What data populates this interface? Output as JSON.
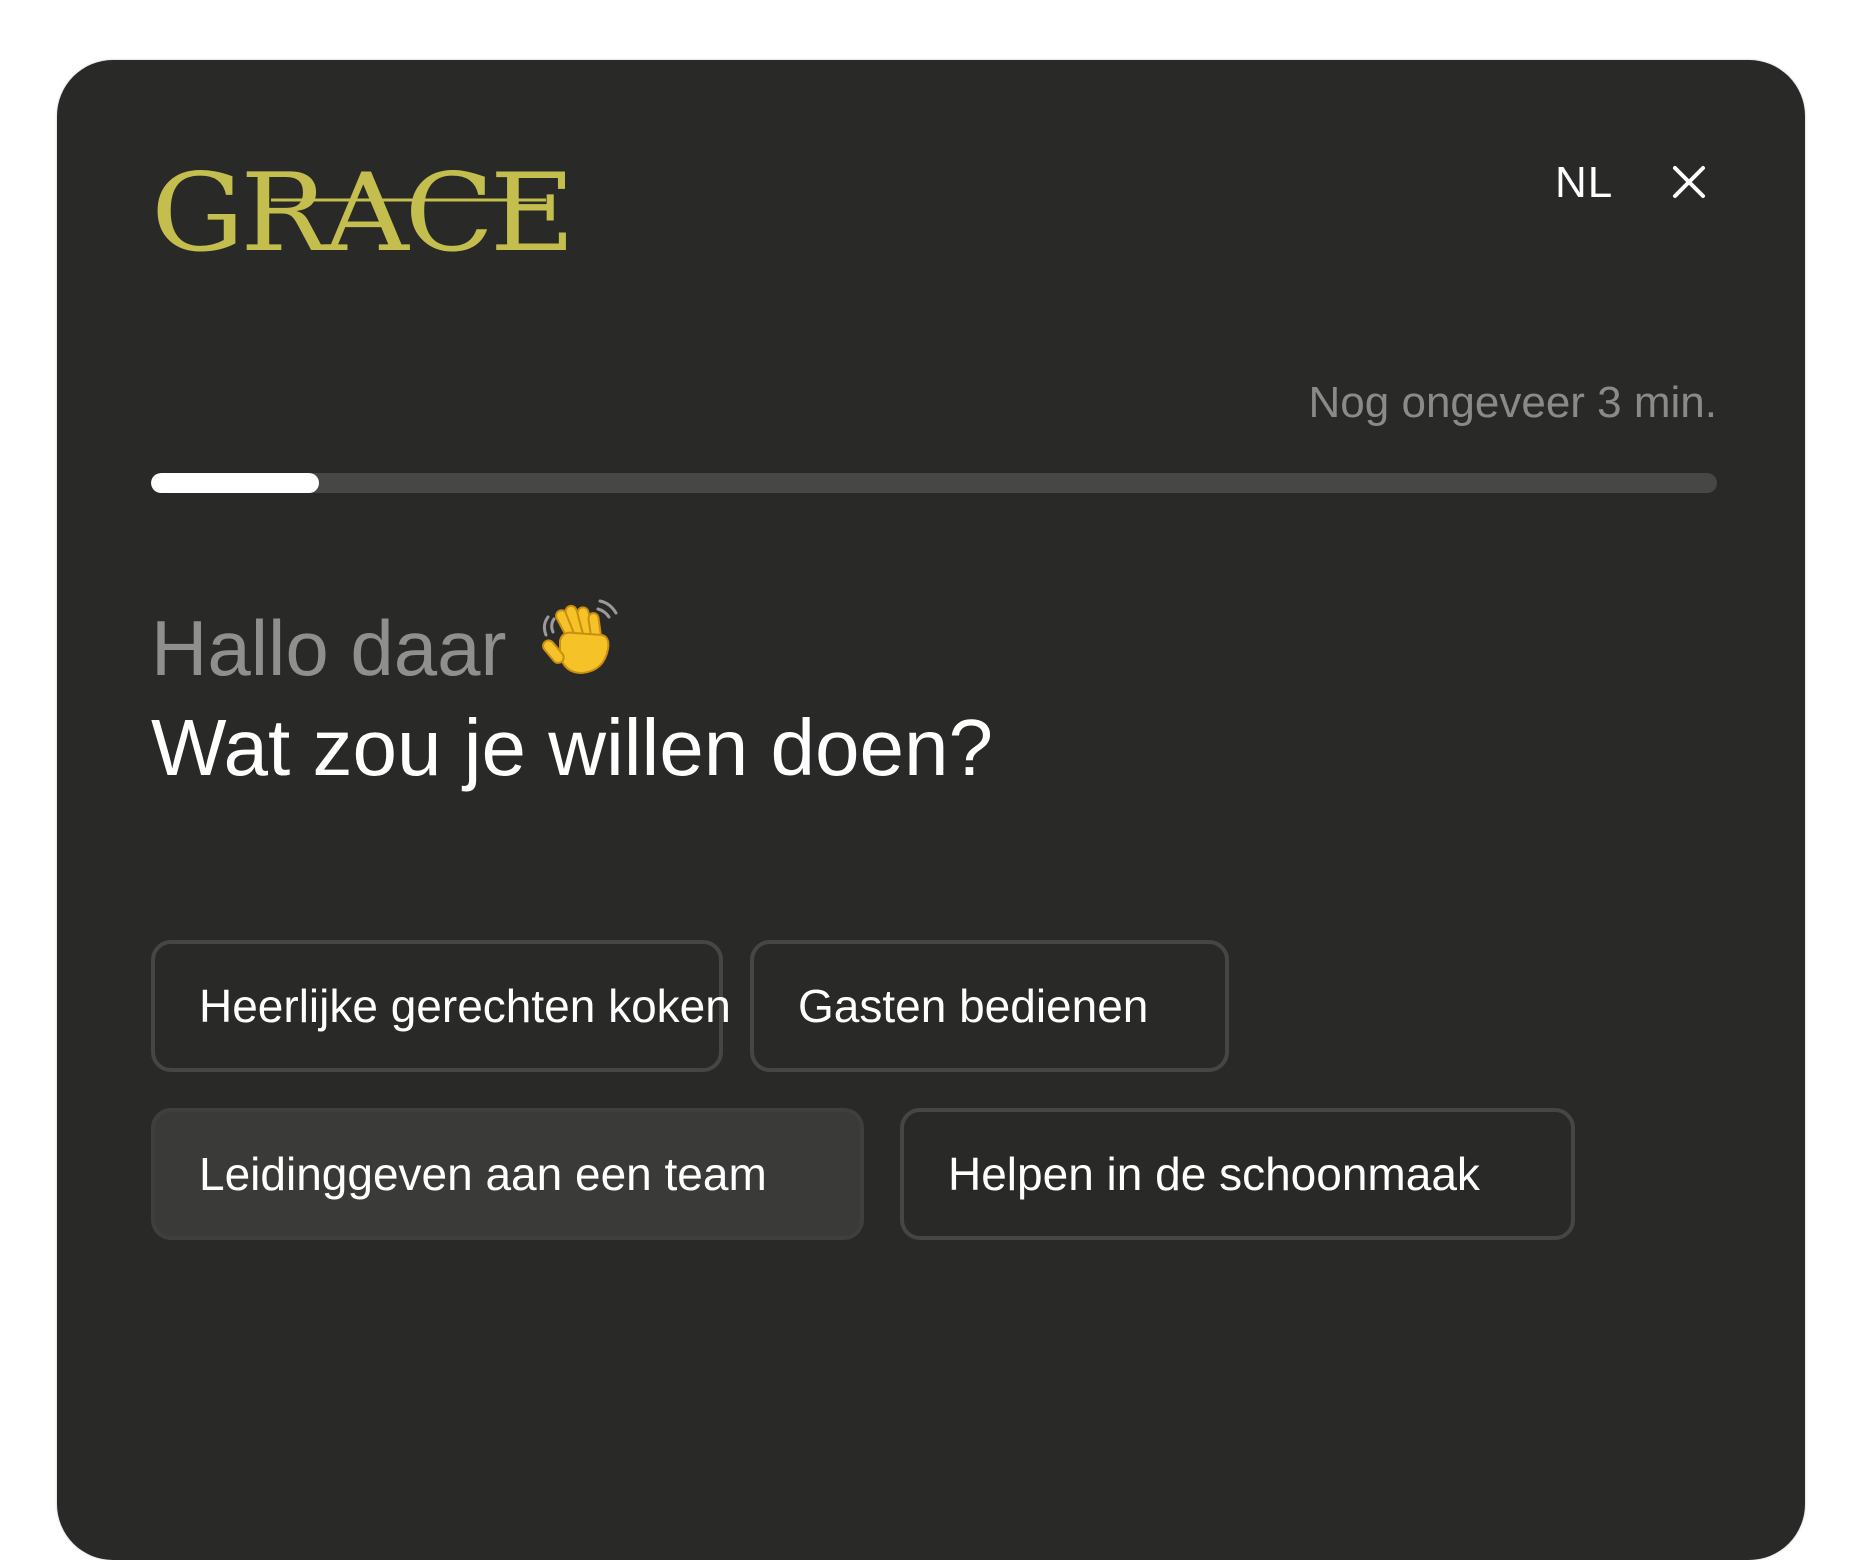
{
  "brand": {
    "logo_text": "GRACE",
    "logo_color": "#c4be4e"
  },
  "header": {
    "language": "NL",
    "close_icon": "close-icon"
  },
  "progress": {
    "time_remaining": "Nog ongeveer 3 min.",
    "fraction": 0.107
  },
  "main": {
    "greeting": "Hallo daar",
    "greeting_icon": "waving-hand-icon",
    "question": "Wat zou je willen doen?",
    "options": [
      {
        "label": "Heerlijke gerechten koken"
      },
      {
        "label": "Gasten bedienen"
      },
      {
        "label": "Leidinggeven aan een team",
        "state": "hover"
      },
      {
        "label": "Helpen in de schoonmaak"
      }
    ]
  },
  "colors": {
    "panel_bg": "#292928",
    "accent": "#c4be4e",
    "muted_text": "#8f8f8d",
    "option_border": "#464645",
    "progress_track": "#474746"
  }
}
